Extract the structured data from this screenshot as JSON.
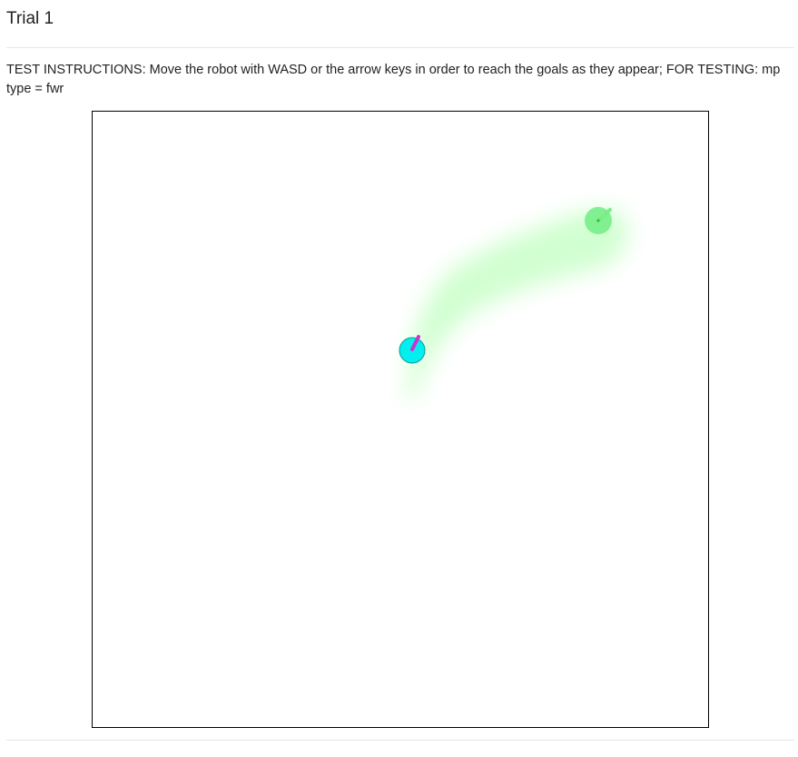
{
  "trial": {
    "title": "Trial 1"
  },
  "instructions": {
    "text": "TEST INSTRUCTIONS: Move the robot with WASD or the arrow keys in order to reach the goals as they appear; FOR TESTING: mp type = fwr"
  },
  "game": {
    "colors": {
      "trail": "#ccffcc",
      "goal": "#77ee88",
      "goal_center": "#33bb44",
      "robot_fill": "#00f0f0",
      "robot_stroke": "#119999",
      "robot_heading": "#cc33cc",
      "border": "#000000"
    },
    "icons": {
      "robot": "robot-circle-icon",
      "goal": "goal-circle-icon"
    }
  }
}
